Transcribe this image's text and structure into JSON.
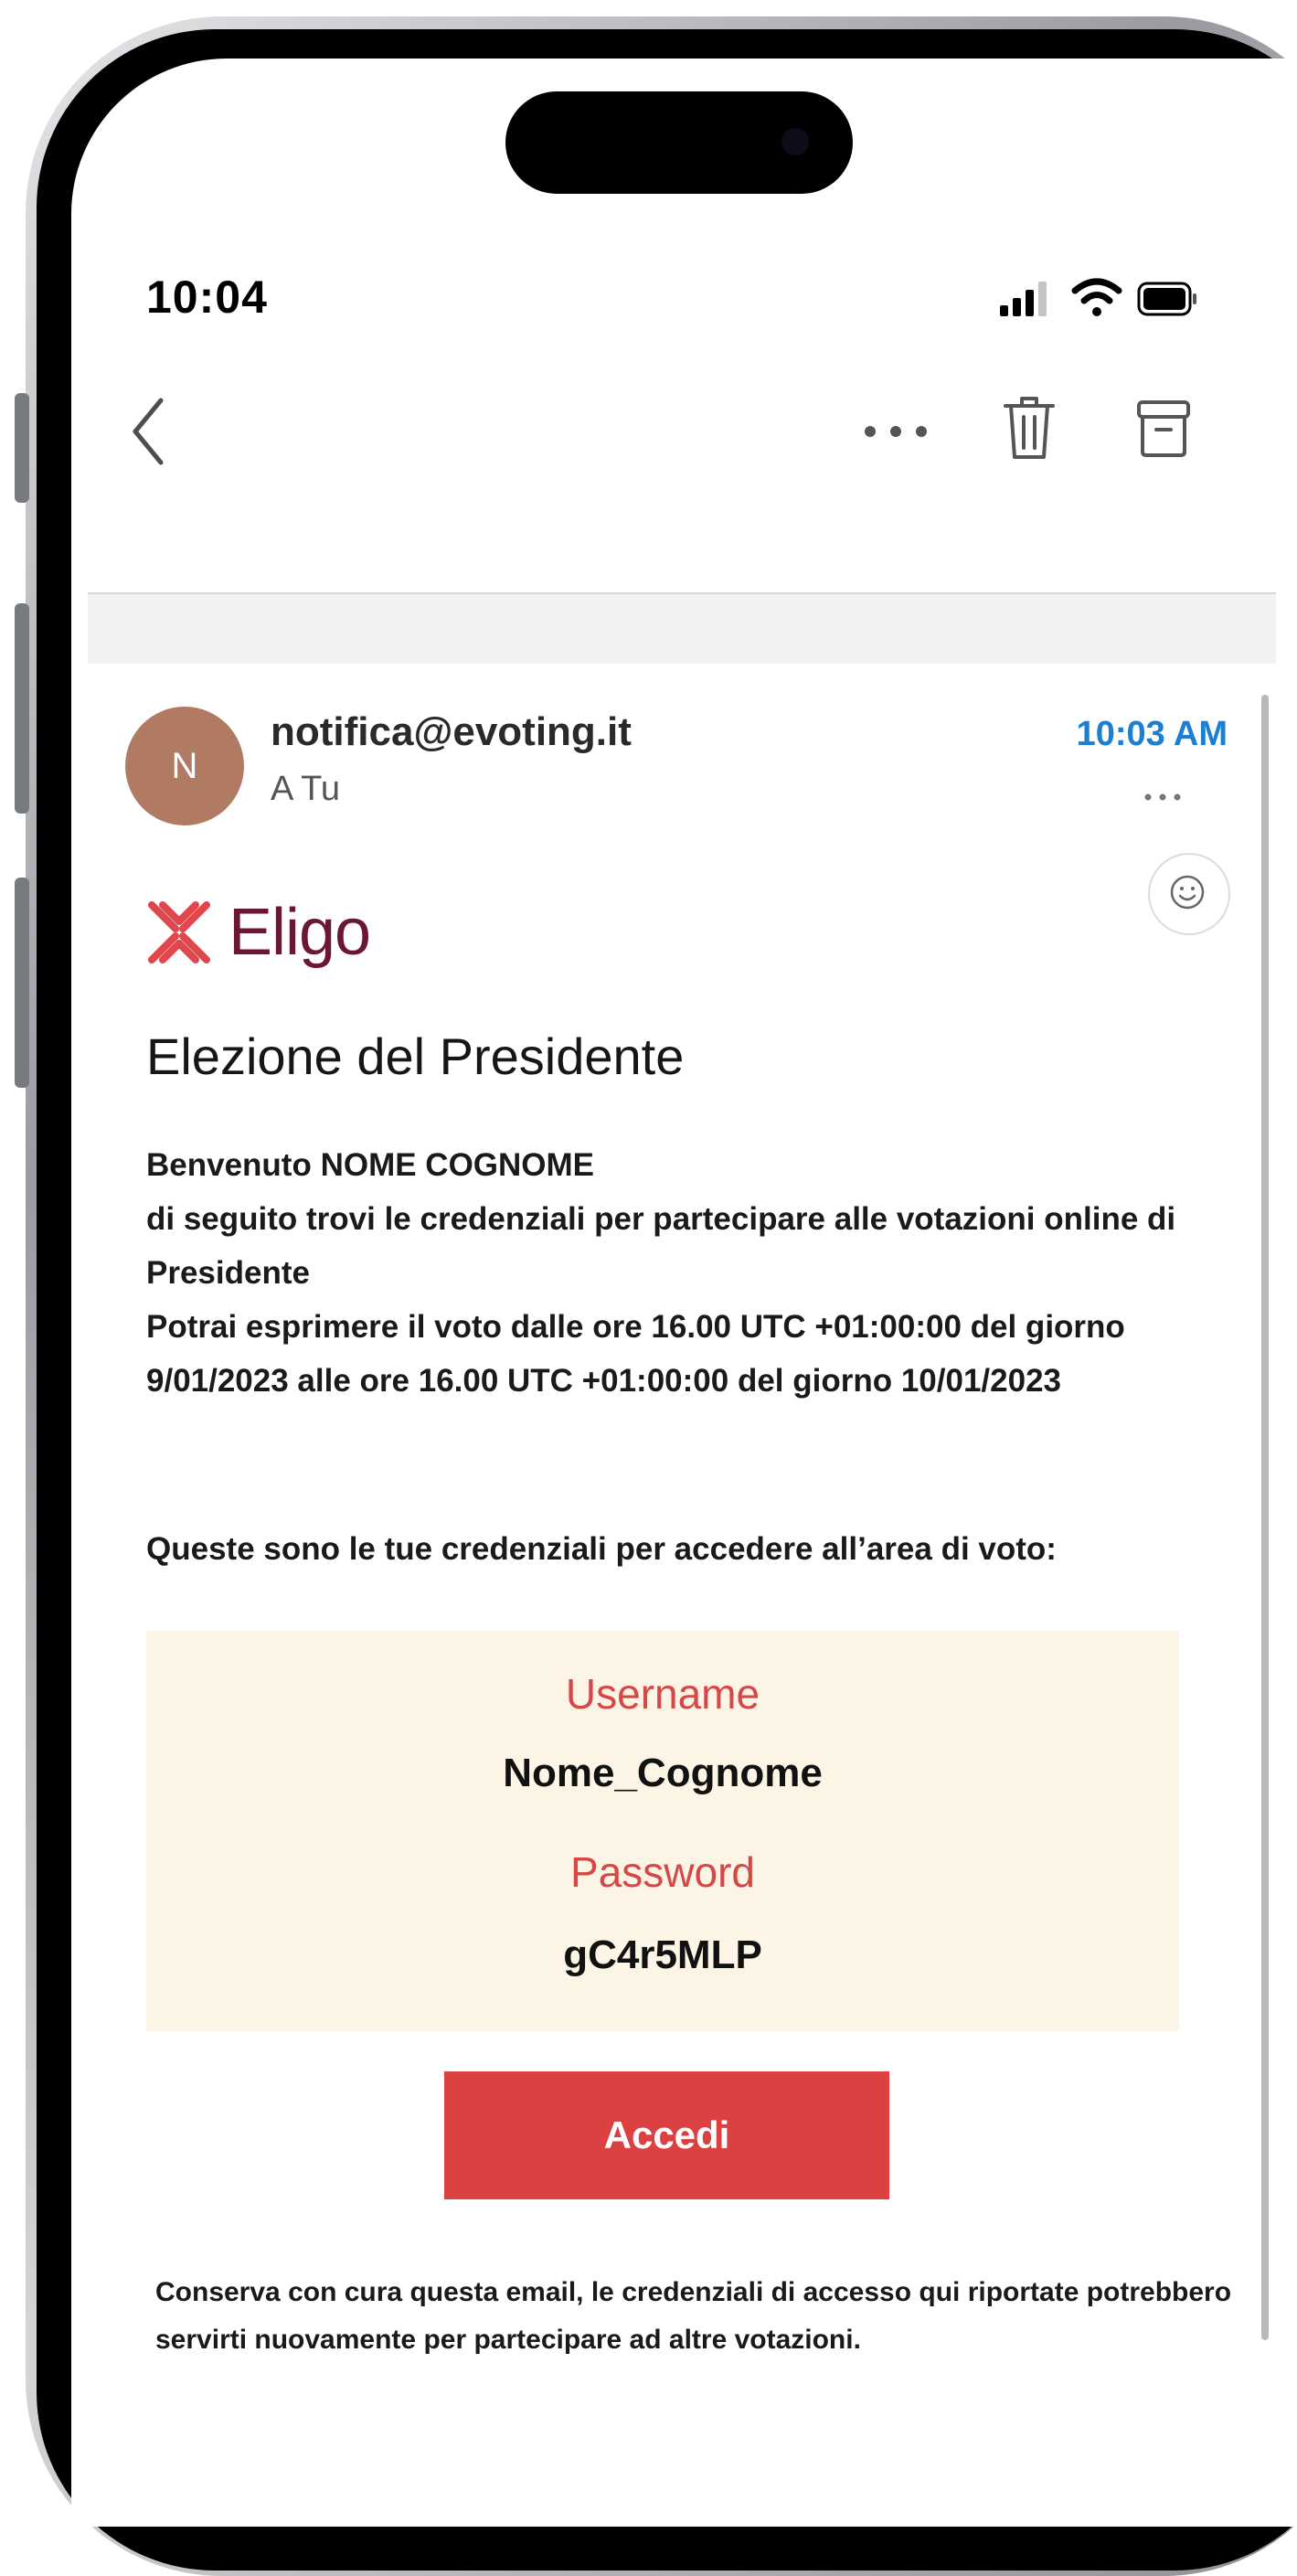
{
  "status_bar": {
    "time": "10:04"
  },
  "email": {
    "avatar_initial": "N",
    "sender": "notifica@evoting.it",
    "recipient": "A Tu",
    "received_time": "10:03 AM"
  },
  "brand": {
    "name": "Eligo",
    "color": "#6b1634",
    "mark_color": "#e0474c"
  },
  "message": {
    "title": "Elezione del Presidente",
    "lines": [
      "Benvenuto NOME COGNOME",
      "di seguito trovi le credenziali per partecipare alle votazioni online di Presidente",
      "Potrai esprimere il voto dalle ore 16.00 UTC +01:00:00 del giorno 9/01/2023 alle ore 16.00 UTC +01:00:00 del giorno 10/01/2023"
    ],
    "credentials_intro": "Queste sono le tue credenziali per accedere all’area di voto:",
    "username_label": "Username",
    "username_value": "Nome_Cognome",
    "password_label": "Password",
    "password_value": "gC4r5MLP",
    "cta_label": "Accedi",
    "footer_note": "Conserva con cura questa email, le credenziali di accesso qui riportate potrebbero servirti nuovamente per partecipare ad altre votazioni."
  },
  "icons": {
    "back": "chevron-left-icon",
    "more": "more-horizontal-icon",
    "trash": "trash-icon",
    "archive": "archive-icon",
    "emoji": "smiley-icon"
  },
  "colors": {
    "accent_blue": "#1c7fd1",
    "cta_red": "#da4140",
    "label_red": "#d64747",
    "credentials_bg": "#fcf4e4",
    "avatar_bg": "#b07a63"
  }
}
